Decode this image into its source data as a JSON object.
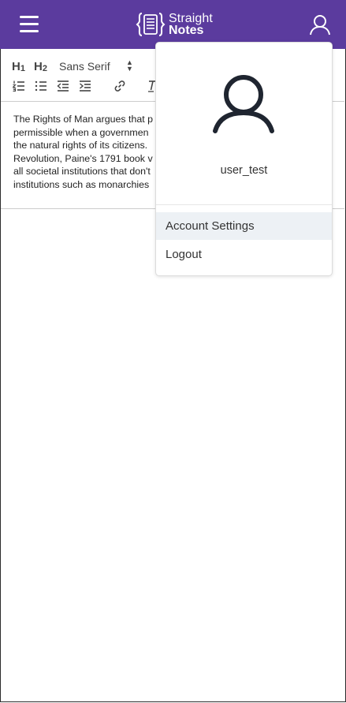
{
  "header": {
    "brand_line1": "Straight",
    "brand_line2": "Notes",
    "bg_color": "#5b3b9e"
  },
  "toolbar": {
    "h1_label": "H",
    "h1_sub": "1",
    "h2_label": "H",
    "h2_sub": "2",
    "font_family_value": "Sans Serif"
  },
  "editor": {
    "lines": [
      "The Rights of Man argues that p",
      "permissible when a governmen",
      "the natural rights of its citizens.",
      "Revolution, Paine's 1791 book v",
      "all societal institutions that don't",
      "institutions such as monarchies"
    ]
  },
  "user_menu": {
    "username": "user_test",
    "items": [
      {
        "label": "Account Settings",
        "highlighted": true
      },
      {
        "label": "Logout",
        "highlighted": false
      }
    ]
  },
  "icons": {
    "menu": "hamburger-icon",
    "brand": "curly-braces-note-icon",
    "user": "user-icon",
    "ordered_list": "ordered-list-icon",
    "bullet_list": "bullet-list-icon",
    "outdent": "outdent-icon",
    "indent": "indent-icon",
    "link": "link-icon",
    "clear_format": "clear-format-icon",
    "avatar": "user-avatar-icon"
  }
}
